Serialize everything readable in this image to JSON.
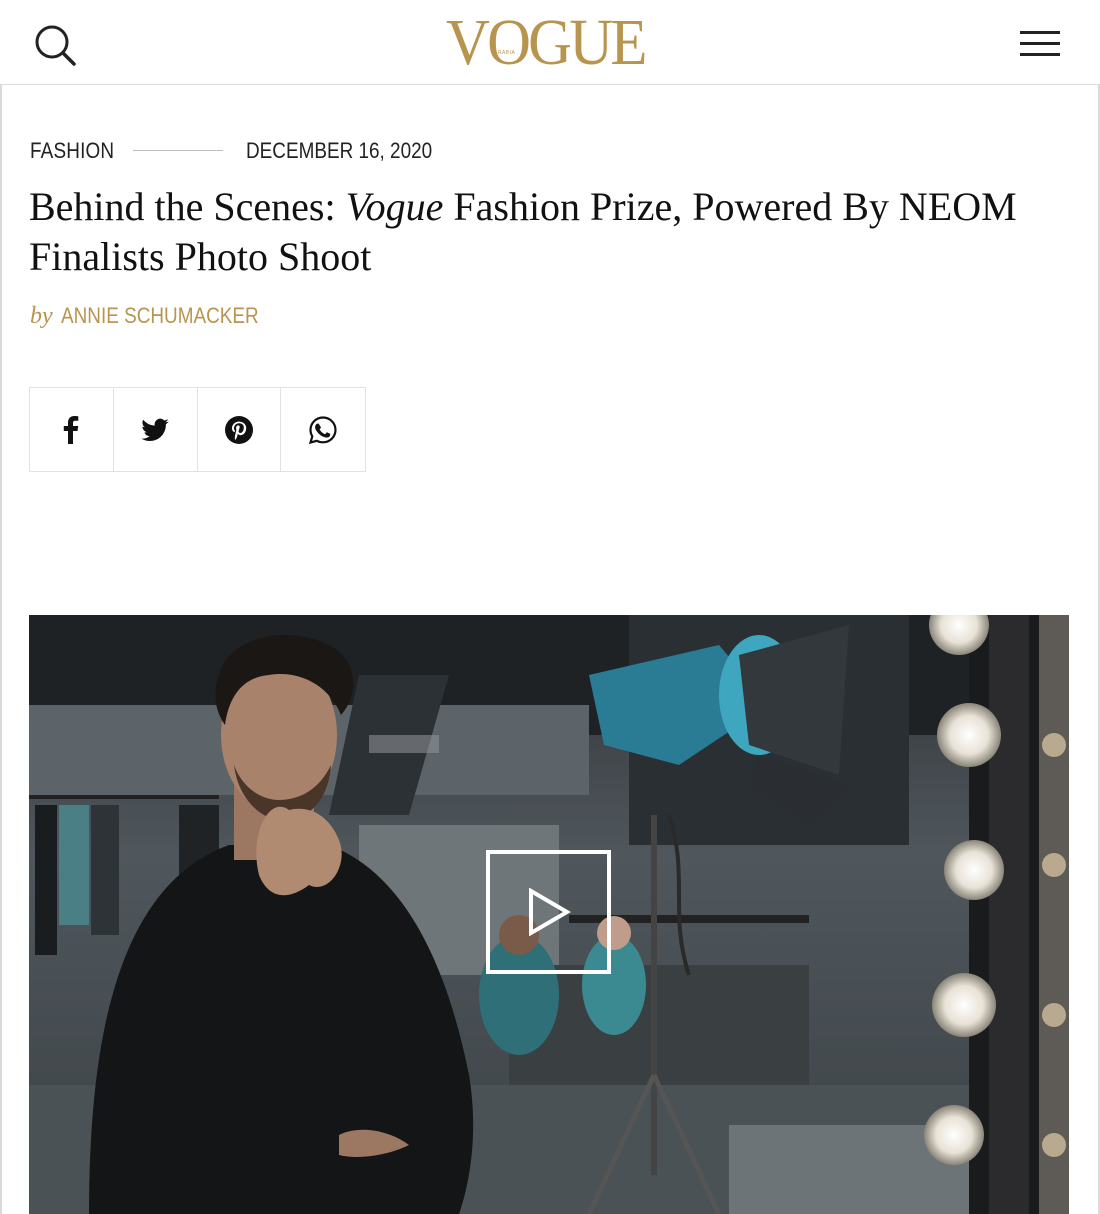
{
  "header": {
    "logo_text": "VOGUE",
    "logo_subtext": "ARABIA",
    "search_icon": "search-icon",
    "menu_icon": "hamburger-menu-icon"
  },
  "article": {
    "category": "FASHION",
    "date": "DECEMBER 16, 2020",
    "title_part1": "Behind the Scenes: ",
    "title_italic": "Vogue",
    "title_part2": " Fashion Prize, Powered By NEOM Finalists Photo Shoot",
    "by_label": "by",
    "author": "ANNIE SCHUMACKER"
  },
  "share": {
    "buttons": [
      {
        "icon": "facebook-icon"
      },
      {
        "icon": "twitter-icon"
      },
      {
        "icon": "pinterest-icon"
      },
      {
        "icon": "whatsapp-icon"
      }
    ]
  },
  "video": {
    "play_icon": "play-icon"
  },
  "colors": {
    "brand_gold": "#b8954f",
    "text": "#111111",
    "border": "#e2e2e2"
  }
}
